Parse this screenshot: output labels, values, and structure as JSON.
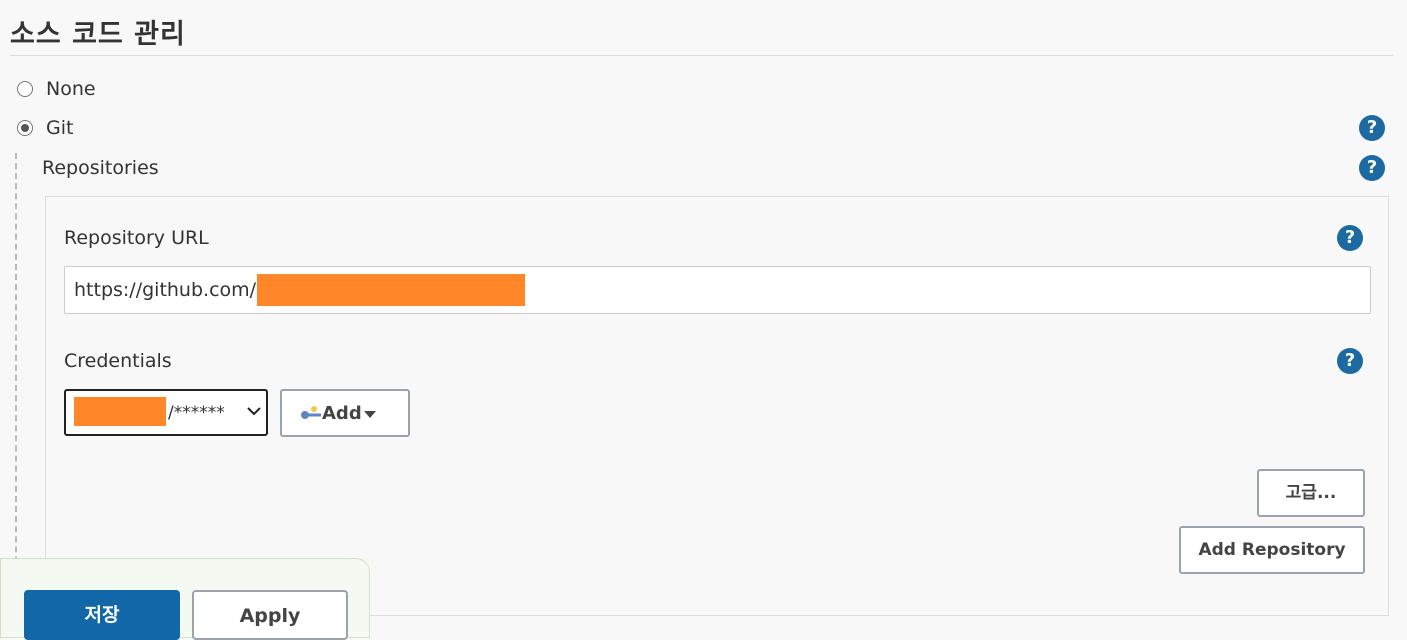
{
  "scm": {
    "title": "소스 코드 관리",
    "options": [
      {
        "label": "None",
        "selected": false
      },
      {
        "label": "Git",
        "selected": true
      }
    ]
  },
  "repositories": {
    "label": "Repositories",
    "repository_url_label": "Repository URL",
    "repository_url_value": "https://github.com/",
    "credentials_label": "Credentials",
    "credentials_value_suffix": "/******",
    "add_label": "Add",
    "advanced_label": "고급...",
    "add_repository_label": "Add Repository"
  },
  "footer": {
    "save_label": "저장",
    "apply_label": "Apply"
  },
  "colors": {
    "help_icon": "#1c6aa1",
    "redaction": "#ff8629",
    "save_button": "#1167a8"
  },
  "help_icon_text": "?"
}
